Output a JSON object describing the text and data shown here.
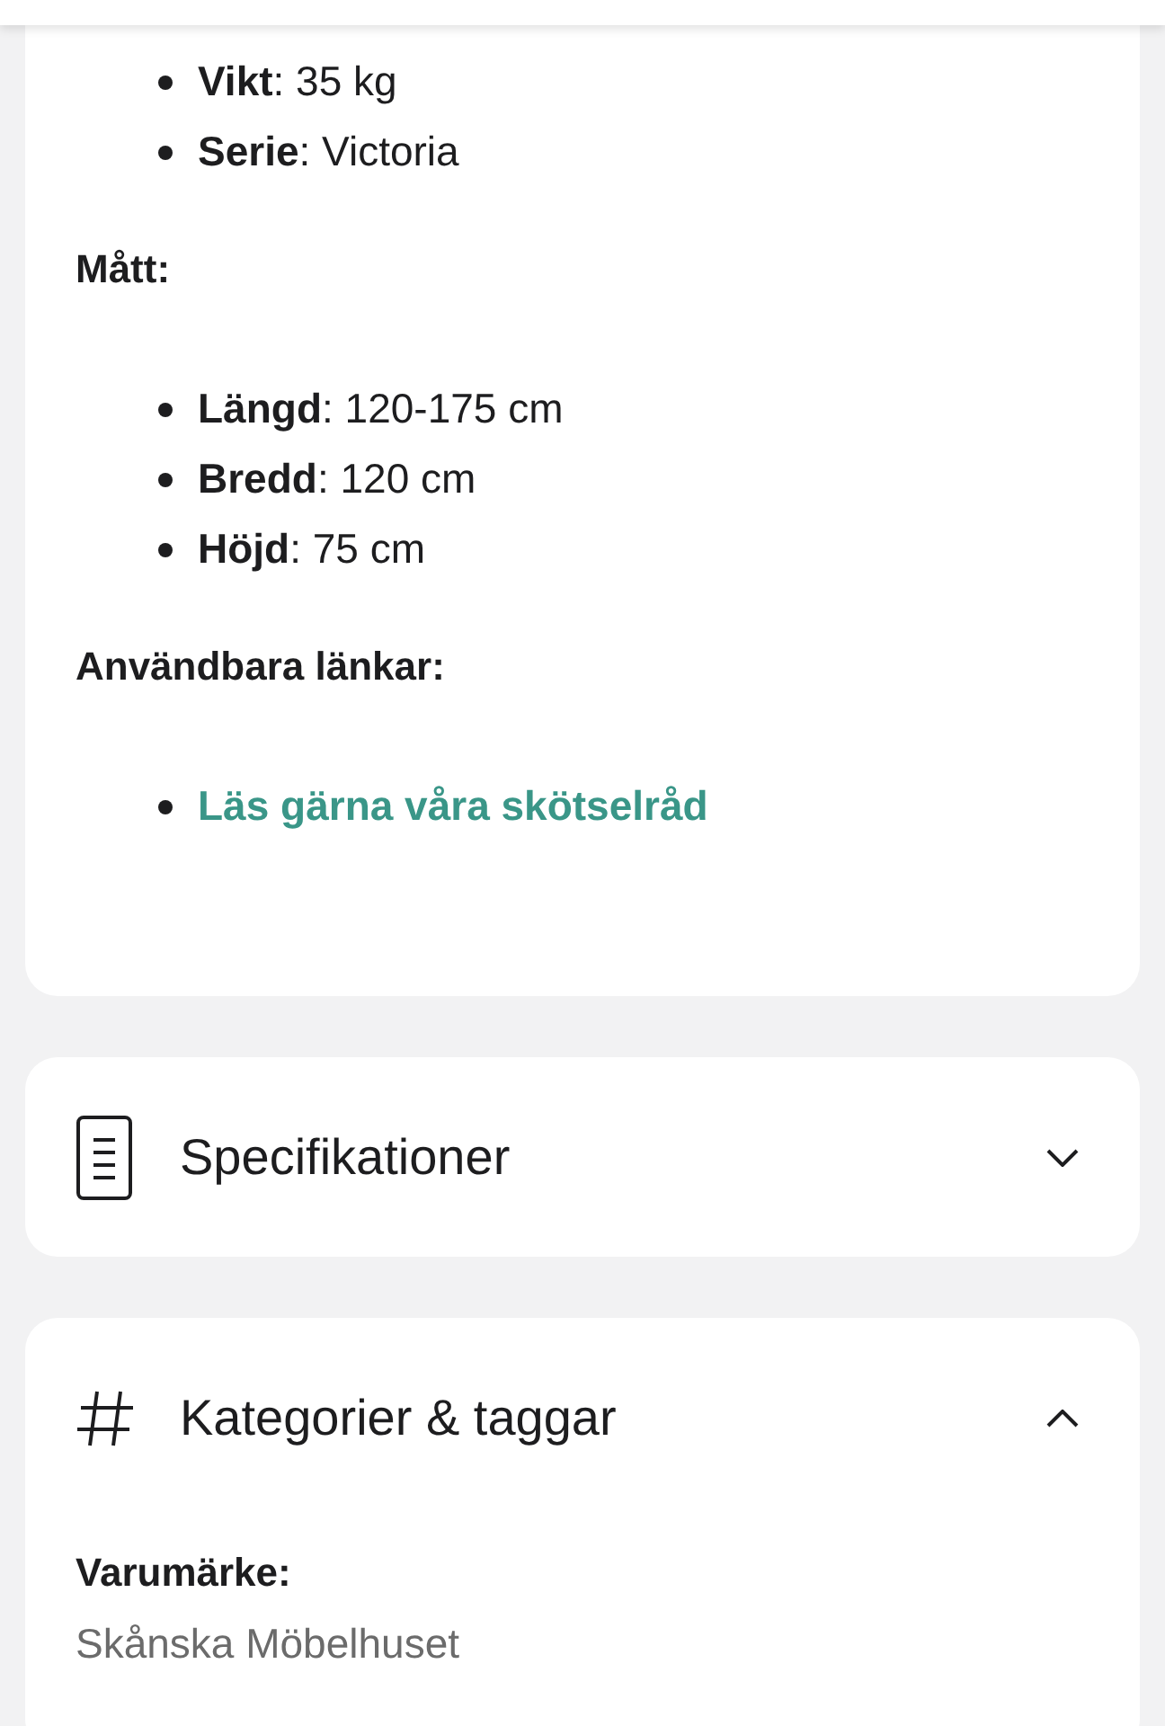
{
  "description": {
    "groups": [
      {
        "items": [
          {
            "label": "Vikt",
            "value": ": 35 kg"
          },
          {
            "label": "Serie",
            "value": ": Victoria"
          }
        ]
      },
      {
        "heading": "Mått:",
        "items": [
          {
            "label": "Längd",
            "value": ": 120-175 cm"
          },
          {
            "label": "Bredd",
            "value": ": 120 cm"
          },
          {
            "label": "Höjd",
            "value": ": 75 cm"
          }
        ]
      },
      {
        "heading": "Användbara länkar:",
        "links": [
          "Läs gärna våra skötselråd"
        ]
      }
    ]
  },
  "accordions": [
    {
      "kind": "document",
      "title": "Specifikationer",
      "expanded": false
    },
    {
      "kind": "hash",
      "title": "Kategorier & taggar",
      "expanded": true,
      "fields": [
        {
          "label": "Varumärke:",
          "value": "Skånska Möbelhuset"
        }
      ]
    }
  ]
}
